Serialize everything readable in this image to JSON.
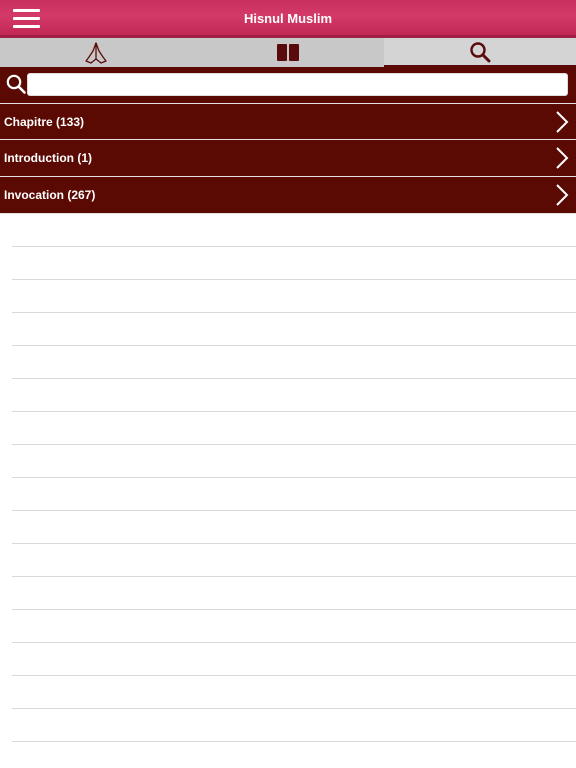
{
  "app": {
    "title": "Hisnul Muslim"
  },
  "navbar": {
    "menu_icon": "hamburger-menu-icon"
  },
  "tabs": [
    {
      "icon": "praying-hands-icon",
      "active": false
    },
    {
      "icon": "open-book-icon",
      "active": false
    },
    {
      "icon": "search-icon",
      "active": true
    }
  ],
  "search": {
    "value": "",
    "placeholder": ""
  },
  "categories": [
    {
      "label": "Chapitre (133)"
    },
    {
      "label": "Introduction (1)"
    },
    {
      "label": "Invocation (267)"
    }
  ],
  "colors": {
    "navbar": "#c92f5e",
    "row_background": "#5a0a02",
    "tabbar": "#c8c8c8"
  }
}
